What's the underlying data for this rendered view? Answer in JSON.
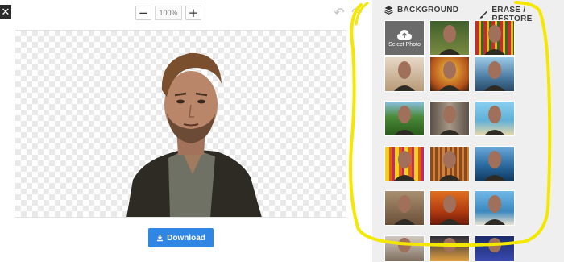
{
  "toolbar": {
    "close_icon": "close-icon",
    "zoom_out": "−",
    "zoom_value": "100%",
    "zoom_in": "+",
    "undo_icon": "undo-icon",
    "redo_icon": "redo-icon"
  },
  "editor": {
    "download_label": "Download"
  },
  "panel": {
    "tabs": [
      {
        "label": "BACKGROUND",
        "icon": "layers-icon"
      },
      {
        "label": "ERASE / RESTORE",
        "icon": "brush-icon"
      }
    ],
    "select_photo_label": "Select Photo",
    "backgrounds": [
      "select-photo",
      "forest",
      "stripes-red",
      "cafe",
      "sunset-orange",
      "city-water",
      "green-hills",
      "street",
      "beach",
      "stripes-yellow",
      "stripes-brown",
      "ocean-rocks",
      "room",
      "autumn",
      "river",
      "cars",
      "night",
      "night-blue"
    ]
  },
  "colors": {
    "accent": "#2f86e3",
    "highlight": "#f5e800",
    "panel_bg": "#efefef"
  }
}
